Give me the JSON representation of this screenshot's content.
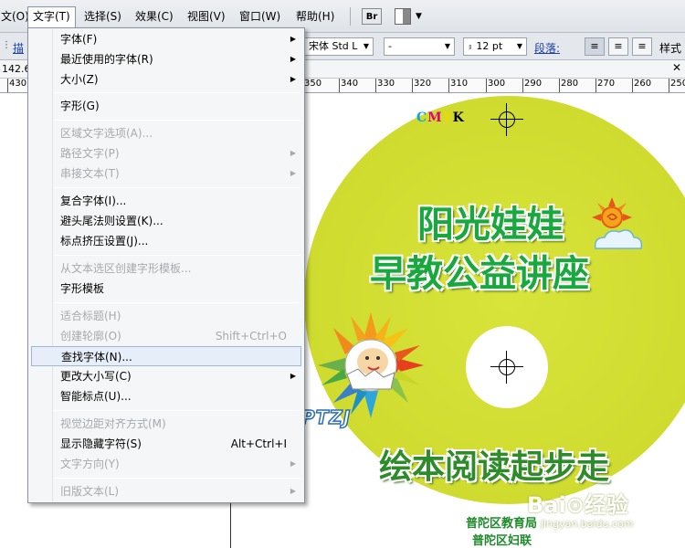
{
  "menubar": {
    "items": [
      "文(O)",
      "文字(T)",
      "选择(S)",
      "效果(C)",
      "视图(V)",
      "窗口(W)",
      "帮助(H)"
    ],
    "br_label": "Br"
  },
  "controlbar": {
    "left_label": "描",
    "font": "宋体 Std L",
    "style": "-",
    "size": "12 pt",
    "paragraph_label": "段落:",
    "more_label": "样式"
  },
  "coord": {
    "value": "142.6"
  },
  "ruler": {
    "ticks": [
      "430",
      "350",
      "340",
      "330",
      "320",
      "310",
      "300",
      "290",
      "280",
      "270",
      "260",
      "250"
    ]
  },
  "menu": {
    "items": [
      {
        "label": "字体(F)",
        "disabled": false,
        "submenu": true
      },
      {
        "label": "最近使用的字体(R)",
        "disabled": false,
        "submenu": true
      },
      {
        "label": "大小(Z)",
        "disabled": false,
        "submenu": true
      },
      {
        "label": "字形(G)",
        "disabled": false
      },
      {
        "label": "区域文字选项(A)...",
        "disabled": true
      },
      {
        "label": "路径文字(P)",
        "disabled": true,
        "submenu": true
      },
      {
        "label": "串接文本(T)",
        "disabled": true,
        "submenu": true
      },
      {
        "label": "复合字体(I)...",
        "disabled": false
      },
      {
        "label": "避头尾法则设置(K)...",
        "disabled": false
      },
      {
        "label": "标点挤压设置(J)...",
        "disabled": false
      },
      {
        "label": "从文本选区创建字形模板...",
        "disabled": true
      },
      {
        "label": "字形模板",
        "disabled": false
      },
      {
        "label": "适合标题(H)",
        "disabled": true
      },
      {
        "label": "创建轮廓(O)",
        "disabled": true,
        "shortcut": "Shift+Ctrl+O"
      },
      {
        "label": "查找字体(N)...",
        "disabled": false,
        "highlighted": true
      },
      {
        "label": "更改大小写(C)",
        "disabled": false,
        "submenu": true
      },
      {
        "label": "智能标点(U)...",
        "disabled": false
      },
      {
        "label": "视觉边距对齐方式(M)",
        "disabled": true
      },
      {
        "label": "显示隐藏字符(S)",
        "disabled": false,
        "shortcut": "Alt+Ctrl+I"
      },
      {
        "label": "文字方向(Y)",
        "disabled": true,
        "submenu": true
      },
      {
        "label": "旧版文本(L)",
        "disabled": true,
        "submenu": true
      }
    ]
  },
  "artwork": {
    "cmyk": [
      "C",
      "M",
      "Y",
      "K"
    ],
    "title_line1": "阳光娃娃",
    "title_line2": "早教公益讲座",
    "subtitle": "绘本阅读起步走",
    "org_line1": "普陀区教育局",
    "org_line2": "普陀区妇联",
    "logo_text": "PTZJ"
  },
  "watermark": {
    "logo": "Bai⊙经验",
    "url": "jingyan.baidu.com"
  },
  "colors": {
    "disc": "#d3df32",
    "title_green": "#18a83e",
    "cmyk": [
      "#00a6e0",
      "#e2007a",
      "#f5e400",
      "#000000"
    ]
  }
}
